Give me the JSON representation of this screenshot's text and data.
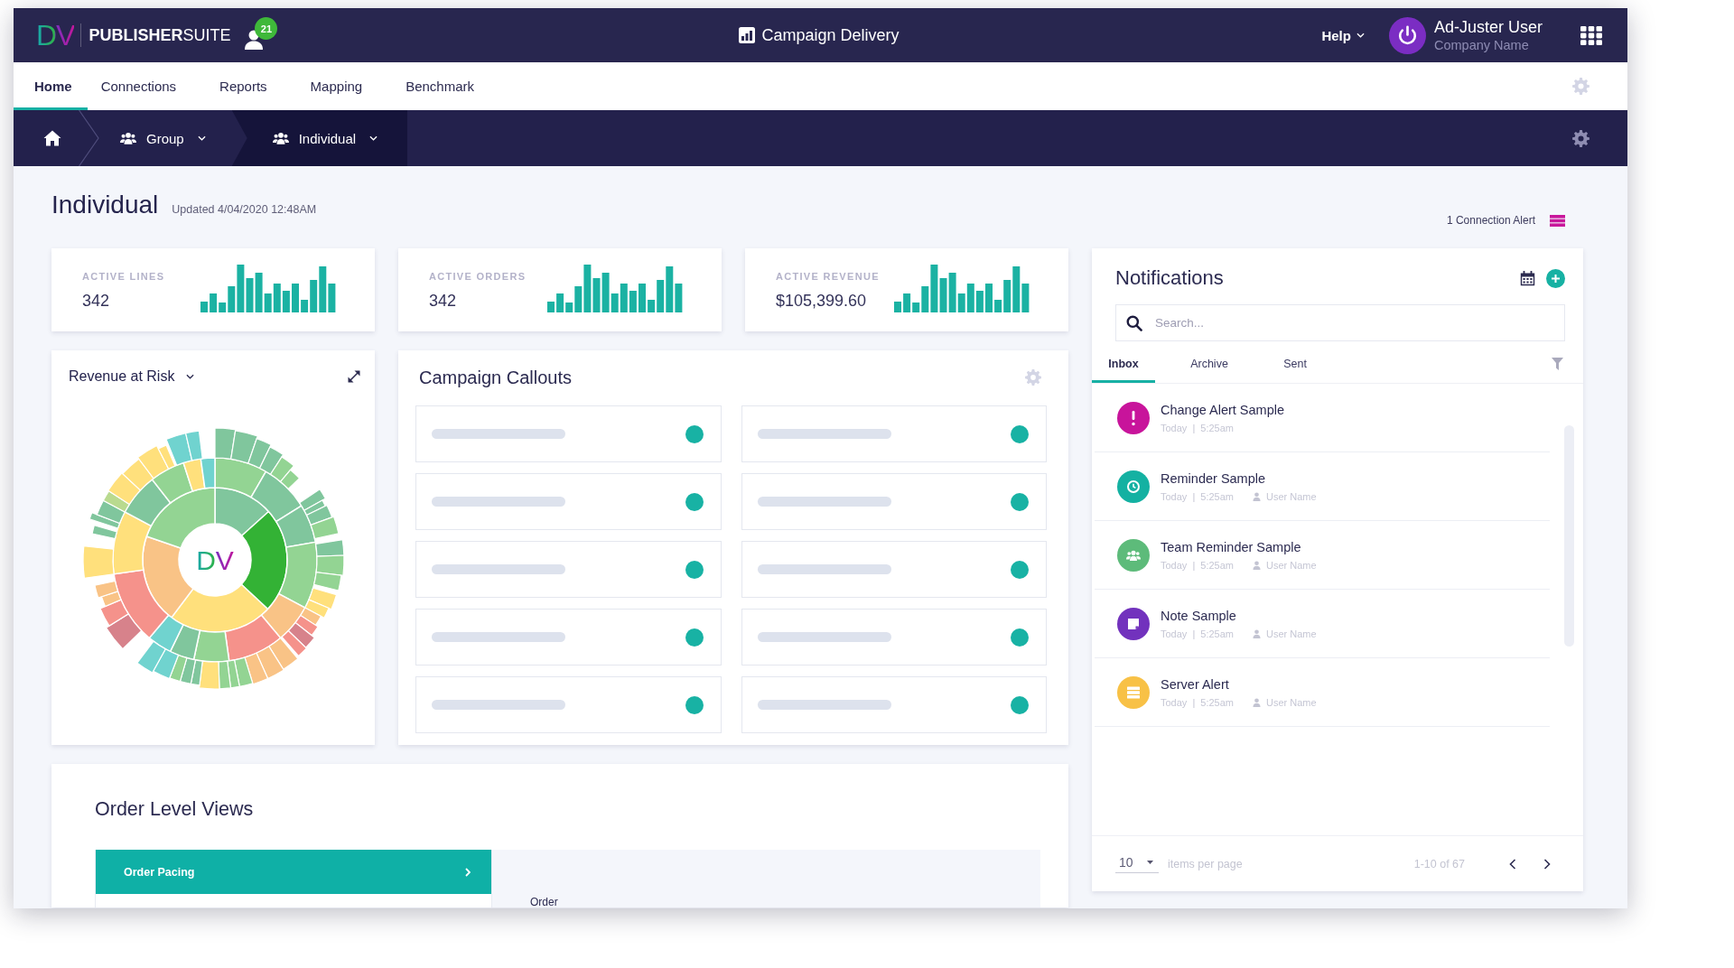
{
  "header": {
    "logo": {
      "mark": "DV",
      "wordmark": "**PUBLISHER**SUITE"
    },
    "badge": "21",
    "app_title": "Campaign Delivery",
    "help": "Help",
    "user": {
      "name": "Ad-Juster User",
      "company": "Company Name"
    }
  },
  "nav": {
    "tabs": [
      {
        "label": "Home",
        "selected": true
      },
      {
        "label": "Connections",
        "selected": false
      },
      {
        "label": "Reports",
        "selected": false
      },
      {
        "label": "Mapping",
        "selected": false
      },
      {
        "label": "Benchmark",
        "selected": false
      }
    ]
  },
  "breadcrumb": [
    {
      "kind": "home",
      "selected": false
    },
    {
      "kind": "group",
      "label": "Group",
      "selected": false
    },
    {
      "kind": "group",
      "label": "Individual",
      "selected": true
    }
  ],
  "heading": {
    "title": "Individual",
    "updated": "Updated 4/04/2020 12:48AM",
    "alert": "1 Connection Alert"
  },
  "kpis": [
    {
      "label": "ACTIVE LINES",
      "value": "342"
    },
    {
      "label": "ACTIVE ORDERS",
      "value": "342"
    },
    {
      "label": "ACTIVE REVENUE",
      "value": "$105,399.60"
    }
  ],
  "revenue_at_risk": {
    "title": "Revenue at Risk",
    "center_label": "DV"
  },
  "campaign_callouts": {
    "title": "Campaign Callouts",
    "items": [
      {
        "kind": "loading"
      },
      {
        "kind": "loading"
      },
      {
        "kind": "loading"
      },
      {
        "kind": "loading"
      },
      {
        "kind": "loading"
      },
      {
        "kind": "loading"
      },
      {
        "kind": "loading"
      },
      {
        "kind": "loading"
      },
      {
        "kind": "loading"
      },
      {
        "kind": "loading"
      }
    ]
  },
  "notifications": {
    "title": "Notifications",
    "search": {
      "placeholder": "Search..."
    },
    "tabs": [
      {
        "label": "Inbox",
        "selected": true
      },
      {
        "label": "Archive",
        "selected": false
      },
      {
        "label": "Sent",
        "selected": false
      }
    ],
    "items": [
      {
        "kind": "alert",
        "color": "#c8149b",
        "title": "Change Alert Sample",
        "when": "Today | 5:25am"
      },
      {
        "kind": "reminder",
        "color": "#14b1a2",
        "title": "Reminder Sample",
        "when": "Today | 5:25am",
        "user": "User Name"
      },
      {
        "kind": "team",
        "color": "#5dbb7a",
        "title": "Team Reminder Sample",
        "when": "Today | 5:25am",
        "user": "User Name"
      },
      {
        "kind": "note",
        "color": "#7232bd",
        "title": "Note Sample",
        "when": "Today | 5:25am",
        "user": "User Name"
      },
      {
        "kind": "server",
        "color": "#f8c146",
        "title": "Server Alert",
        "when": "Today | 5:25am",
        "user": "User Name"
      }
    ],
    "pagination": {
      "page_size": "10",
      "page_size_label": "items per page",
      "range": "1-10 of 67"
    }
  },
  "order_level_views": {
    "title": "Order Level Views",
    "menu": [
      {
        "label": "Order Pacing",
        "selected": true
      }
    ],
    "panel_label": "Order"
  }
}
